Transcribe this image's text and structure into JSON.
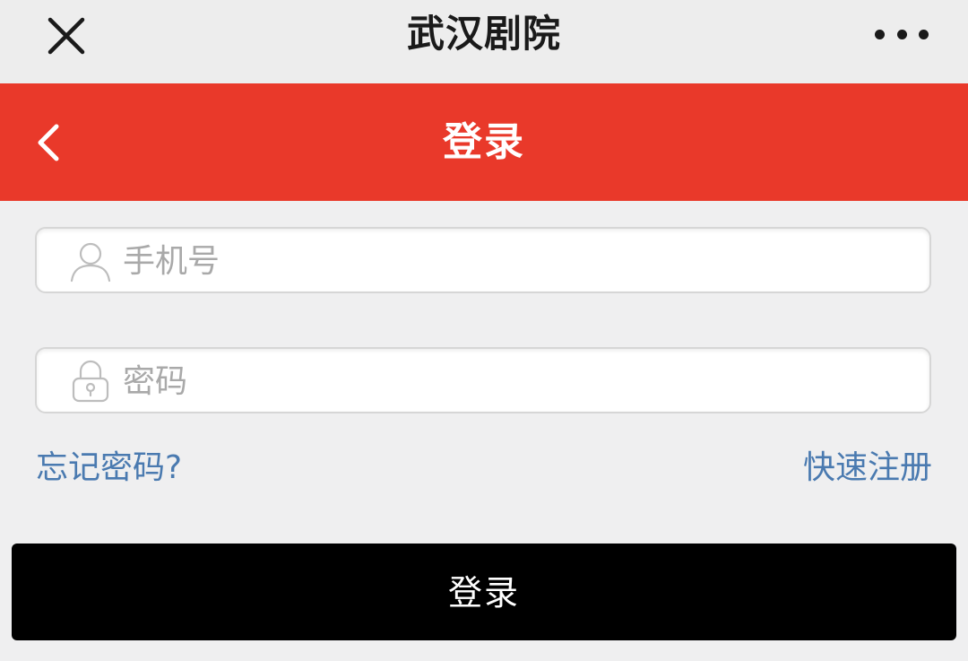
{
  "window": {
    "title": "武汉剧院",
    "close_icon": "close-icon",
    "more_icon": "more-icon"
  },
  "header": {
    "title": "登录",
    "back_icon": "chevron-left-icon",
    "color": "#e9392a"
  },
  "form": {
    "phone": {
      "placeholder": "手机号",
      "value": "",
      "icon": "user-icon"
    },
    "password": {
      "placeholder": "密码",
      "value": "",
      "icon": "lock-icon"
    },
    "forgot_label": "忘记密码?",
    "register_label": "快速注册",
    "submit_label": "登录"
  },
  "colors": {
    "accent": "#e9392a",
    "link": "#4a7ab0",
    "button": "#000000"
  }
}
